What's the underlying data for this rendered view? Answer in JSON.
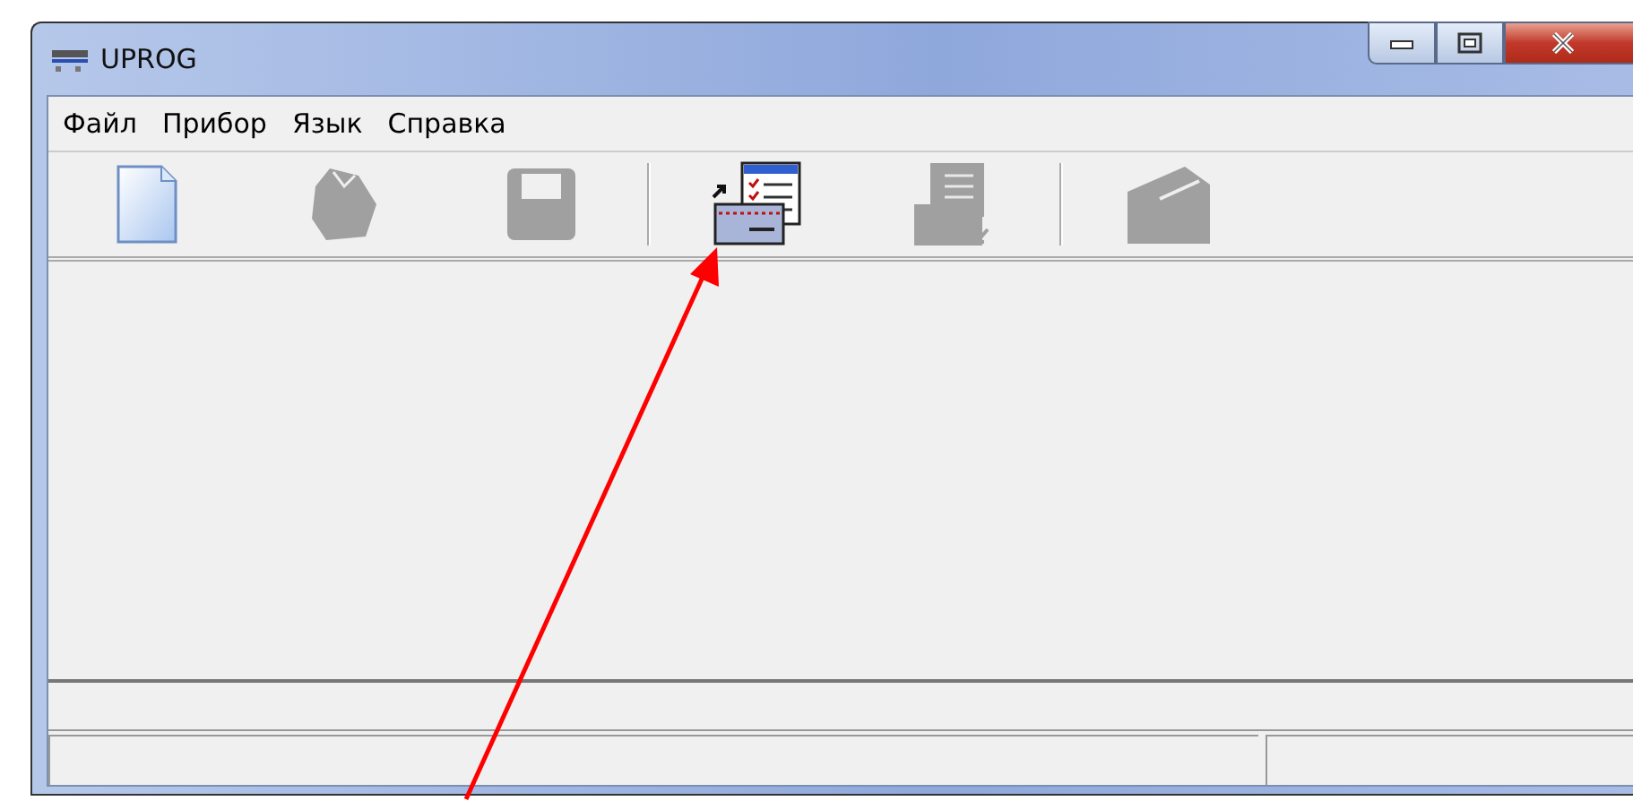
{
  "window": {
    "title": "UPROG"
  },
  "menu": [
    {
      "label": "Файл"
    },
    {
      "label": "Прибор"
    },
    {
      "label": "Язык"
    },
    {
      "label": "Справка"
    }
  ],
  "toolbar": [
    {
      "kind": "new",
      "disabled": false
    },
    {
      "kind": "open",
      "disabled": true
    },
    {
      "kind": "save",
      "disabled": true
    },
    {
      "kind": "separator"
    },
    {
      "kind": "read",
      "disabled": false
    },
    {
      "kind": "write",
      "disabled": true
    },
    {
      "kind": "separator"
    },
    {
      "kind": "device",
      "disabled": true
    }
  ]
}
